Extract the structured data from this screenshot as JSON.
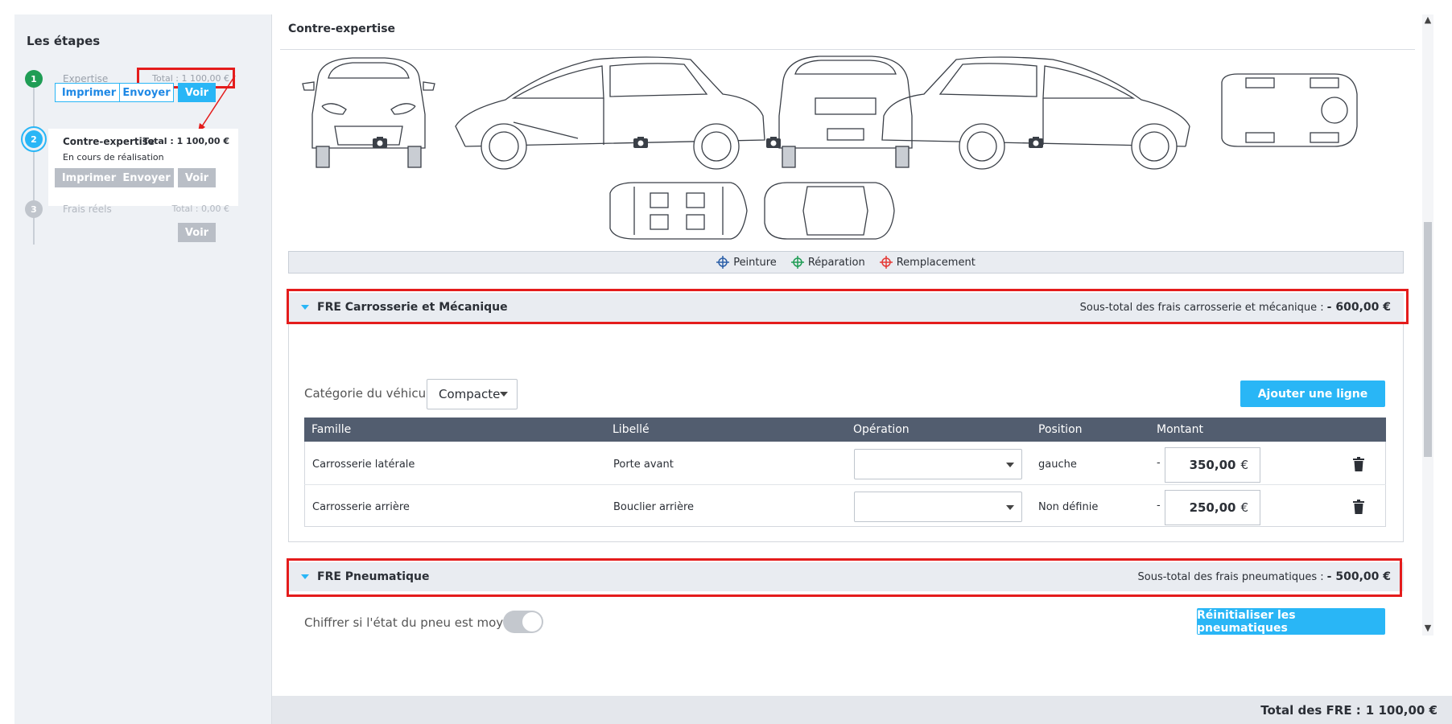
{
  "sidebar": {
    "title": "Les étapes",
    "steps": [
      {
        "number": "1",
        "name": "Expertise",
        "total": "Total : 1 100,00 €",
        "buttons": [
          "Imprimer",
          "Envoyer",
          "Voir"
        ],
        "color": "#1f9d55"
      },
      {
        "number": "2",
        "name": "Contre-expertise",
        "total": "Total : 1 100,00 €",
        "status": "En cours de réalisation",
        "buttons": [
          "Imprimer",
          "Envoyer",
          "Voir"
        ],
        "color": "#29b6f6"
      },
      {
        "number": "3",
        "name": "Frais réels",
        "total": "Total : 0,00 €",
        "buttons": [
          "Voir"
        ],
        "color": "#c0c5cc"
      }
    ]
  },
  "main": {
    "title": "Contre-expertise",
    "legend": {
      "paint": "Peinture",
      "repair": "Réparation",
      "replace": "Remplacement",
      "paint_color": "#2b5fa8",
      "repair_color": "#1f9d55",
      "replace_color": "#e53935"
    },
    "carrosserie": {
      "title": "FRE Carrosserie et Mécanique",
      "subtotal_label": "Sous-total des frais carrosserie et mécanique :",
      "subtotal_value": "- 600,00 €",
      "category_label": "Catégorie du véhicule",
      "category_value": "Compacte",
      "add_button": "Ajouter une ligne",
      "columns": [
        "Famille",
        "Libellé",
        "Opération",
        "Position",
        "Montant"
      ],
      "rows": [
        {
          "famille": "Carrosserie latérale",
          "libelle": "Porte avant",
          "operation": "",
          "position": "gauche",
          "sign": "-",
          "montant": "350,00",
          "currency": "€"
        },
        {
          "famille": "Carrosserie arrière",
          "libelle": "Bouclier arrière",
          "operation": "",
          "position": "Non définie",
          "sign": "-",
          "montant": "250,00",
          "currency": "€"
        }
      ]
    },
    "pneumatique": {
      "title": "FRE Pneumatique",
      "subtotal_label": "Sous-total des frais pneumatiques :",
      "subtotal_value": "- 500,00 €",
      "toggle_label": "Chiffrer si l'état du pneu est moyen",
      "reset_button": "Réinitialiser les pneumatiques"
    }
  },
  "footer": {
    "total_label": "Total des FRE :",
    "total_value": "1 100,00 €"
  },
  "colors": {
    "accent": "#29b6f6",
    "header_dark": "#525d6f",
    "highlight": "#e41c1c"
  }
}
